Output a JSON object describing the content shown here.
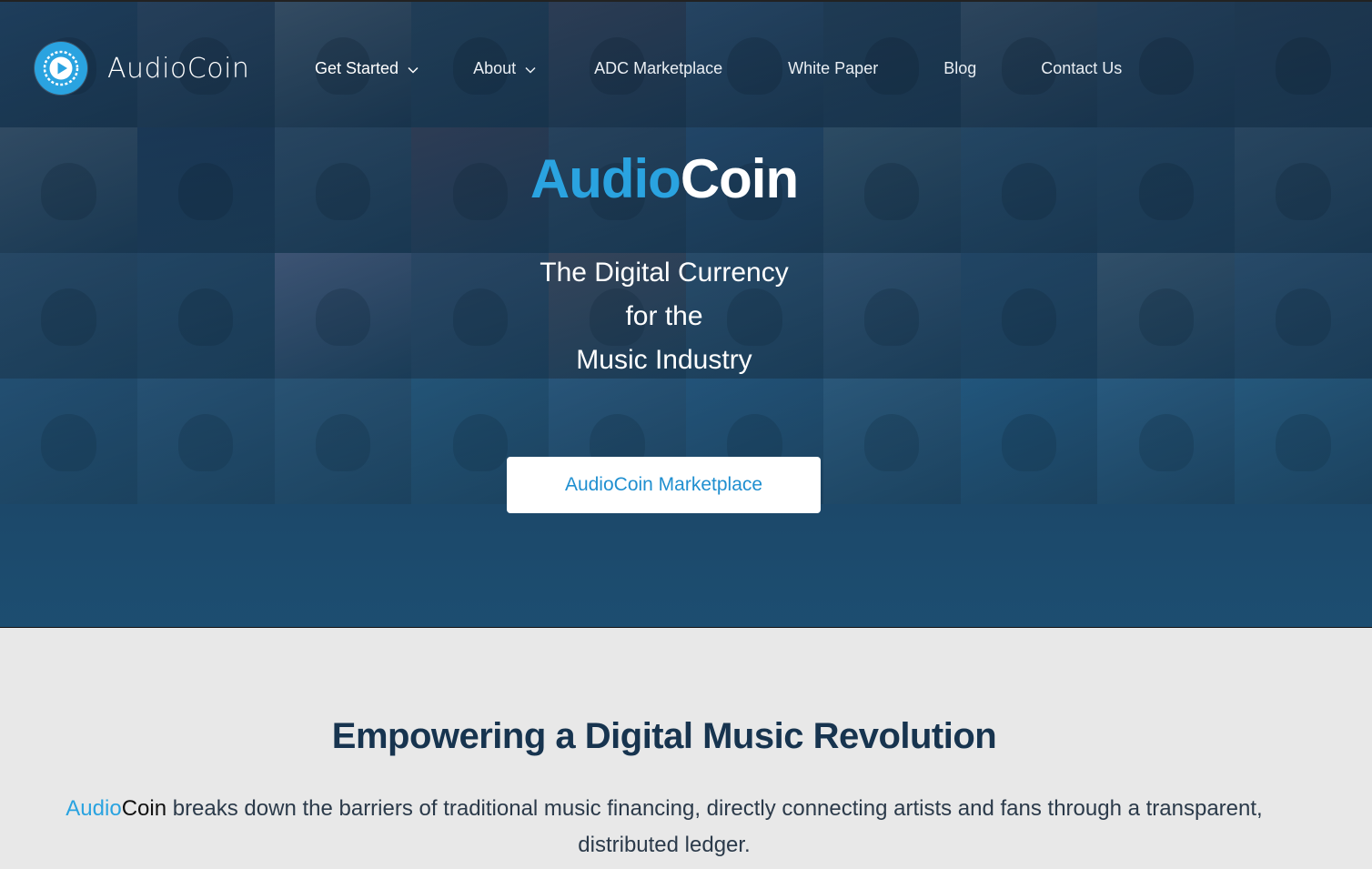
{
  "brand": {
    "name": "AudioCoin",
    "accent": "#2aa3e0"
  },
  "nav": {
    "items": [
      {
        "label": "Get Started",
        "has_dropdown": true
      },
      {
        "label": "About",
        "has_dropdown": true
      },
      {
        "label": "ADC Marketplace",
        "has_dropdown": false
      },
      {
        "label": "White Paper",
        "has_dropdown": false
      },
      {
        "label": "Blog",
        "has_dropdown": false
      },
      {
        "label": "Contact Us",
        "has_dropdown": false
      }
    ]
  },
  "hero": {
    "title_part1": "Audio",
    "title_part2": "Coin",
    "tagline": [
      "The Digital Currency",
      "for the",
      "Music Industry"
    ],
    "cta_label": "AudioCoin Marketplace",
    "tile_colors": [
      "#2a4c6a",
      "#3b4f66",
      "#5a6a78",
      "#2f4a5e",
      "#4a4a5a",
      "#3a5a78",
      "#2c4457",
      "#4b5c6c",
      "#354d63",
      "#2b3f52",
      "#51606f",
      "#1f3551",
      "#3d5368",
      "#4a3f4f",
      "#3a4c60",
      "#2f5478",
      "#47606f",
      "#34556f",
      "#2d4960",
      "#3e5467",
      "#385068",
      "#2e4a64",
      "#6a6a88",
      "#3f4e66",
      "#5a4a50",
      "#3b5872",
      "#49607a",
      "#2c4a66",
      "#4f6070",
      "#3a5570",
      "#2e5678",
      "#355a7a",
      "#3c5f7c",
      "#2f6284",
      "#3a6488",
      "#2d6088",
      "#3f6a8a",
      "#2b6690",
      "#3a6e94",
      "#336a8e"
    ]
  },
  "intro": {
    "heading": "Empowering a Digital Music Revolution",
    "brand_part1": "Audio",
    "brand_part2": "Coin",
    "body_rest": " breaks down the barriers of traditional music financing, directly connecting artists and fans through a transparent, distributed ledger."
  }
}
